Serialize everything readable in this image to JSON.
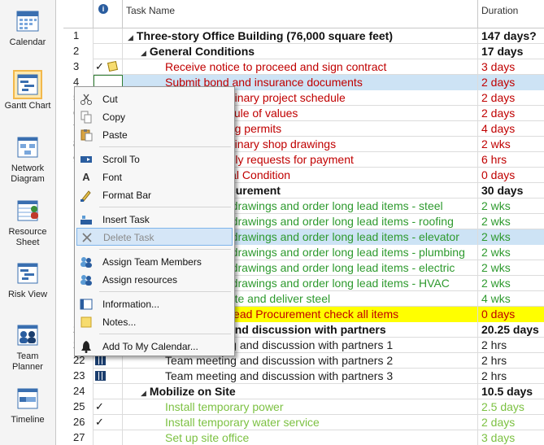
{
  "views": [
    {
      "label": "Calendar",
      "icon": "calendar-icon"
    },
    {
      "label": "Gantt Chart",
      "icon": "gantt-chart-icon"
    },
    {
      "label": "Network Diagram",
      "icon": "network-diagram-icon"
    },
    {
      "label": "Resource Sheet",
      "icon": "resource-sheet-icon"
    },
    {
      "label": "Risk View",
      "icon": "risk-view-icon"
    },
    {
      "label": "Team Planner",
      "icon": "team-planner-icon"
    },
    {
      "label": "Timeline",
      "icon": "timeline-icon"
    }
  ],
  "header": {
    "info_icon": "i",
    "task_name": "Task Name",
    "duration": "Duration"
  },
  "rows": [
    {
      "id": "1",
      "name": "Three-story Office Building (76,000 square feet)",
      "dur": "147 days?"
    },
    {
      "id": "2",
      "name": "General Conditions",
      "dur": "17 days"
    },
    {
      "id": "3",
      "name": "Receive notice to proceed and sign contract",
      "dur": "3 days"
    },
    {
      "id": "4",
      "name": "Submit bond and insurance documents",
      "dur": "2 days"
    },
    {
      "id": "5",
      "name": "Submit preliminary project schedule",
      "dur": "2 days"
    },
    {
      "id": "6",
      "name": "Submit schedule of values",
      "dur": "2 days"
    },
    {
      "id": "7",
      "name": "Obtain building permits",
      "dur": "4 days"
    },
    {
      "id": "8",
      "name": "Submit preliminary shop drawings",
      "dur": "2 wks"
    },
    {
      "id": "9",
      "name": "Submit monthly requests for payment",
      "dur": "6 hrs"
    },
    {
      "id": "10",
      "name": "Finish General Condition",
      "dur": "0 days"
    },
    {
      "id": "11",
      "name": "Long Lead Procurement",
      "dur": "30 days"
    },
    {
      "id": "12",
      "name": "Submit shop drawings and order long lead items - steel",
      "dur": "2 wks"
    },
    {
      "id": "13",
      "name": "Submit shop drawings and order long lead items - roofing",
      "dur": "2 wks"
    },
    {
      "id": "14",
      "name": "Submit shop drawings and order long lead items - elevator",
      "dur": "2 wks"
    },
    {
      "id": "15",
      "name": "Submit shop drawings and order long lead items - plumbing",
      "dur": "2 wks"
    },
    {
      "id": "16",
      "name": "Submit shop drawings and order long lead items - electric",
      "dur": "2 wks"
    },
    {
      "id": "17",
      "name": "Submit shop drawings and order long lead items - HVAC",
      "dur": "2 wks"
    },
    {
      "id": "18",
      "name": "Detail, fabricate and deliver steel",
      "dur": "4 wks"
    },
    {
      "id": "19",
      "name": "Finish Long Lead Procurement check all items",
      "dur": "0 days"
    },
    {
      "id": "20",
      "name": "Team meeting and discussion with partners",
      "dur": "20.25 days"
    },
    {
      "id": "21",
      "name": "Team meeting and discussion with partners 1",
      "dur": "2 hrs"
    },
    {
      "id": "22",
      "name": "Team meeting and discussion with partners 2",
      "dur": "2 hrs"
    },
    {
      "id": "23",
      "name": "Team meeting and discussion with partners 3",
      "dur": "2 hrs"
    },
    {
      "id": "24",
      "name": "Mobilize on Site",
      "dur": "10.5 days"
    },
    {
      "id": "25",
      "name": "Install temporary power",
      "dur": "2.5 days"
    },
    {
      "id": "26",
      "name": "Install temporary water service",
      "dur": "2 days"
    },
    {
      "id": "27",
      "name": "Set up site office",
      "dur": "3 days"
    }
  ],
  "menu": {
    "cut": "Cut",
    "copy": "Copy",
    "paste": "Paste",
    "scroll_to": "Scroll To",
    "font": "Font",
    "format_bar": "Format Bar",
    "insert_task": "Insert Task",
    "delete_task": "Delete Task",
    "assign_team_members": "Assign Team Members",
    "assign_resources": "Assign resources",
    "information": "Information...",
    "notes": "Notes...",
    "add_to_calendar": "Add To My Calendar..."
  },
  "colors": {
    "late_task": "#c00000",
    "ok_task": "#2e9a2e",
    "done_task": "#7cc142",
    "selected_row": "#cde3f5",
    "highlight_row": "#ffff00"
  }
}
